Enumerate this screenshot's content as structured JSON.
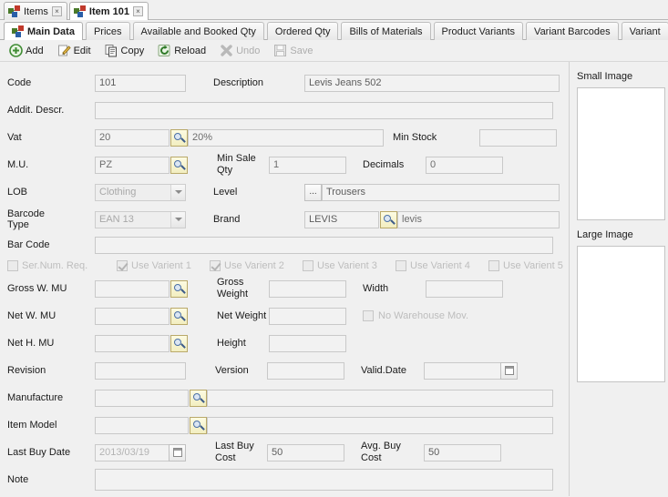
{
  "window_tabs": [
    {
      "label": "Items",
      "active": false,
      "close": "×"
    },
    {
      "label": "Item 101",
      "active": true,
      "close": "×"
    }
  ],
  "notebook_tabs": [
    {
      "label": "Main Data",
      "active": true
    },
    {
      "label": "Prices",
      "active": false
    },
    {
      "label": "Available and Booked Qty",
      "active": false
    },
    {
      "label": "Ordered Qty",
      "active": false
    },
    {
      "label": "Bills of Materials",
      "active": false
    },
    {
      "label": "Product Variants",
      "active": false
    },
    {
      "label": "Variant Barcodes",
      "active": false
    },
    {
      "label": "Variant",
      "active": false
    }
  ],
  "toolbar": [
    {
      "label": "Add",
      "icon": "add-icon",
      "disabled": false
    },
    {
      "label": "Edit",
      "icon": "edit-icon",
      "disabled": false
    },
    {
      "label": "Copy",
      "icon": "copy-icon",
      "disabled": false
    },
    {
      "label": "Reload",
      "icon": "reload-icon",
      "disabled": false
    },
    {
      "label": "Undo",
      "icon": "undo-icon",
      "disabled": true
    },
    {
      "label": "Save",
      "icon": "save-icon",
      "disabled": true
    }
  ],
  "form": {
    "code": {
      "label": "Code",
      "value": "101"
    },
    "description": {
      "label": "Description",
      "value": "Levis Jeans 502"
    },
    "addit_descr": {
      "label": "Addit. Descr.",
      "value": ""
    },
    "vat": {
      "label": "Vat",
      "value": "20",
      "desc": "20%"
    },
    "min_stock": {
      "label": "Min Stock",
      "value": ""
    },
    "mu": {
      "label": "M.U.",
      "value": "PZ"
    },
    "min_sale_qty": {
      "label": "Min Sale Qty",
      "value": "1"
    },
    "decimals": {
      "label": "Decimals",
      "value": "0"
    },
    "lob": {
      "label": "LOB",
      "value": "Clothing"
    },
    "level": {
      "label": "Level",
      "value": "Trousers",
      "button": "..."
    },
    "barcode_type": {
      "label": "Barcode Type",
      "value": "EAN 13"
    },
    "brand": {
      "label": "Brand",
      "value": "LEVIS",
      "desc": "levis"
    },
    "bar_code": {
      "label": "Bar Code",
      "value": ""
    },
    "gross_w_mu": {
      "label": "Gross W. MU",
      "value": ""
    },
    "gross_weight": {
      "label": "Gross Weight",
      "value": ""
    },
    "width": {
      "label": "Width",
      "value": ""
    },
    "net_w_mu": {
      "label": "Net W. MU",
      "value": ""
    },
    "net_weight": {
      "label": "Net Weight",
      "value": ""
    },
    "net_h_mu": {
      "label": "Net H. MU",
      "value": ""
    },
    "height": {
      "label": "Height",
      "value": ""
    },
    "revision": {
      "label": "Revision",
      "value": ""
    },
    "version": {
      "label": "Version",
      "value": ""
    },
    "valid_date": {
      "label": "Valid.Date",
      "value": ""
    },
    "manufacture": {
      "label": "Manufacture",
      "value": ""
    },
    "item_model": {
      "label": "Item Model",
      "value": ""
    },
    "last_buy_date": {
      "label": "Last Buy Date",
      "value": "2013/03/19"
    },
    "last_buy_cost": {
      "label": "Last Buy Cost",
      "value": "50"
    },
    "avg_buy_cost": {
      "label": "Avg. Buy Cost",
      "value": "50"
    },
    "note": {
      "label": "Note",
      "value": ""
    }
  },
  "checkboxes": [
    {
      "label": "Ser.Num. Req.",
      "checked": false,
      "disabled": true
    },
    {
      "label": "Use Varient 1",
      "checked": true,
      "disabled": true
    },
    {
      "label": "Use Varient 2",
      "checked": true,
      "disabled": true
    },
    {
      "label": "Use Varient 3",
      "checked": false,
      "disabled": true
    },
    {
      "label": "Use Varient 4",
      "checked": false,
      "disabled": true
    },
    {
      "label": "Use Varient 5",
      "checked": false,
      "disabled": true
    }
  ],
  "no_warehouse_mov": {
    "label": "No Warehouse Mov.",
    "checked": false,
    "disabled": true
  },
  "images": {
    "small_label": "Small Image",
    "large_label": "Large Image"
  },
  "colors": {
    "accent_green": "#3f8b33",
    "lookup_bg": "#f7f3cd",
    "window_bg": "#f0f0f0",
    "field_bg": "#f2f2f2"
  }
}
